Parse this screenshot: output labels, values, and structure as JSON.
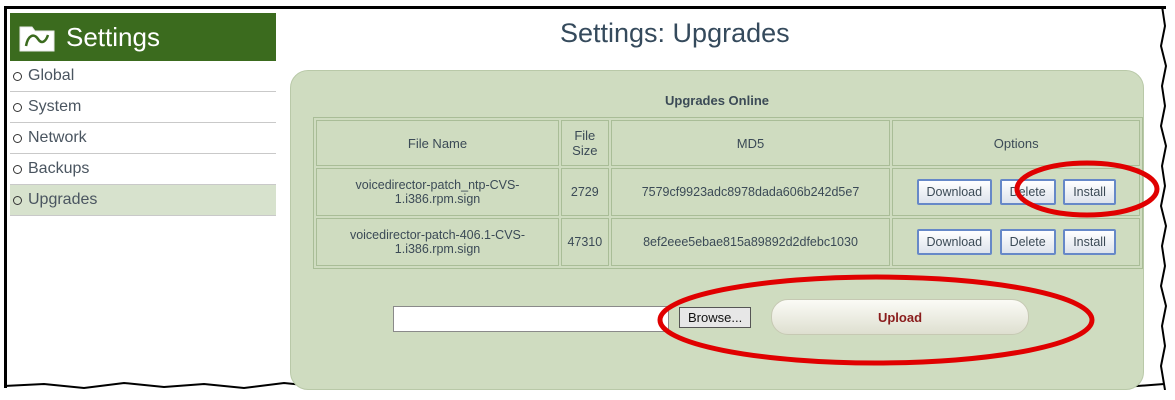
{
  "sidebar": {
    "title": "Settings",
    "items": [
      {
        "label": "Global"
      },
      {
        "label": "System"
      },
      {
        "label": "Network"
      },
      {
        "label": "Backups"
      },
      {
        "label": "Upgrades",
        "active": true
      }
    ]
  },
  "page_title": "Settings: Upgrades",
  "upgrades": {
    "caption": "Upgrades Online",
    "headers": {
      "file_name": "File Name",
      "file_size": "File Size",
      "md5": "MD5",
      "options": "Options"
    },
    "rows": [
      {
        "file_name": "voicedirector-patch_ntp-CVS-1.i386.rpm.sign",
        "file_size": "2729",
        "md5": "7579cf9923adc8978dada606b242d5e7",
        "download": "Download",
        "delete": "Delete",
        "install": "Install"
      },
      {
        "file_name": "voicedirector-patch-406.1-CVS-1.i386.rpm.sign",
        "file_size": "47310",
        "md5": "8ef2eee5ebae815a89892d2dfebc1030",
        "download": "Download",
        "delete": "Delete",
        "install": "Install"
      }
    ]
  },
  "upload": {
    "file_value": "",
    "browse_label": "Browse...",
    "upload_label": "Upload"
  },
  "colors": {
    "sidebar_header": "#3b6b1e",
    "panel_bg": "#cfdcc0",
    "annotation": "#e00000",
    "upload_text": "#8a1c1c"
  }
}
